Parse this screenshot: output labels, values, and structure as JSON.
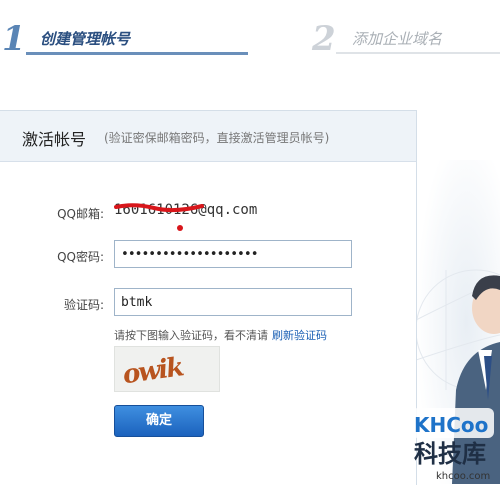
{
  "steps": [
    {
      "number": "1",
      "label": "创建管理帐号"
    },
    {
      "number": "2",
      "label": "添加企业域名"
    }
  ],
  "panel": {
    "title": "激活帐号",
    "subtitle": "(验证密保邮箱密码，直接激活管理员帐号)"
  },
  "form": {
    "email_label": "QQ邮箱:",
    "email_value": "1601610126@qq.com",
    "password_label": "QQ密码:",
    "password_value": "••••••••••••••••••••",
    "captcha_label": "验证码:",
    "captcha_value": "btmk",
    "hint_text": "请按下图输入验证码，看不清请",
    "refresh_link": "刷新验证码",
    "captcha_image_text": "owik",
    "submit_label": "确定"
  },
  "watermark": {
    "logo_text": "KHCoo",
    "name": "科技库",
    "url": "khcoo.com"
  },
  "colors": {
    "accent": "#1b62bd",
    "step_active": "#2b4f80",
    "step_inactive": "#a9afb5"
  }
}
